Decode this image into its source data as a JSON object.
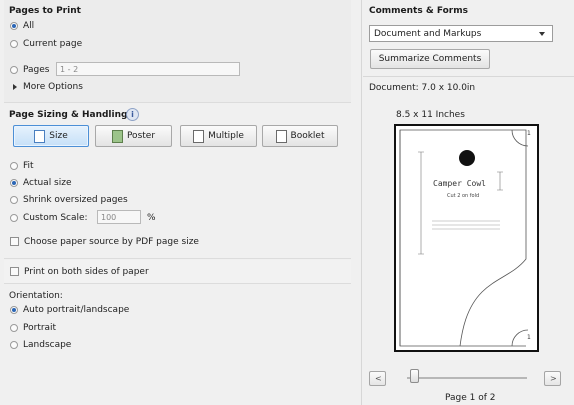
{
  "pages_to_print": {
    "heading": "Pages to Print",
    "all_label": "All",
    "current_label": "Current page",
    "pages_label": "Pages",
    "pages_value": "1 - 2",
    "more_options": "More Options"
  },
  "sizing": {
    "heading": "Page Sizing & Handling",
    "buttons": {
      "size": "Size",
      "poster": "Poster",
      "multiple": "Multiple",
      "booklet": "Booklet"
    },
    "fit_label": "Fit",
    "actual_label": "Actual size",
    "shrink_label": "Shrink oversized pages",
    "custom_label": "Custom Scale:",
    "custom_value": "100",
    "custom_unit": "%",
    "choose_source_label": "Choose paper source by PDF page size"
  },
  "duplex": {
    "label": "Print on both sides of paper"
  },
  "orientation": {
    "heading": "Orientation:",
    "auto_label": "Auto portrait/landscape",
    "portrait_label": "Portrait",
    "landscape_label": "Landscape"
  },
  "comments": {
    "heading": "Comments & Forms",
    "select_value": "Document and Markups",
    "summarize_button": "Summarize Comments"
  },
  "preview": {
    "document_size": "Document: 7.0 x 10.0in",
    "paper_size": "8.5 x 11 Inches",
    "page_title": "Camper Cowl",
    "page_subtitle": "Cut 2 on fold",
    "corner_top": "1",
    "corner_bottom": "1",
    "page_indicator": "Page 1 of 2"
  },
  "colors": {
    "accent": "#2b66b5",
    "active_button": "#c6e0f8"
  }
}
